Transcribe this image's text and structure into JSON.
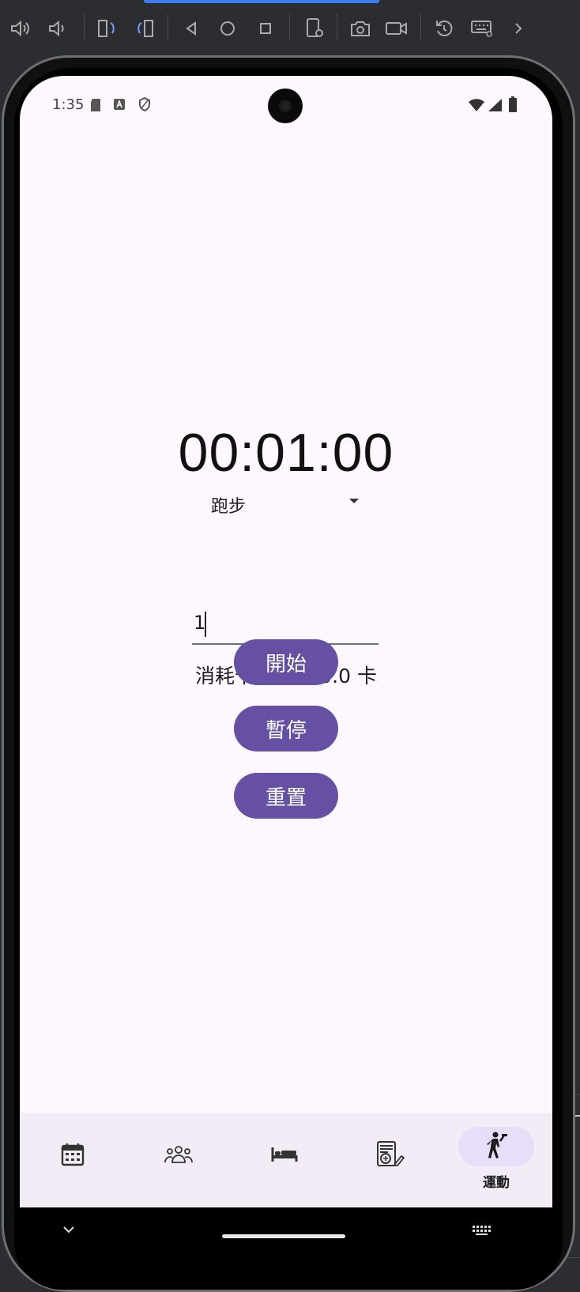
{
  "status_bar": {
    "time": "1:35",
    "icons": [
      "sd-card-icon",
      "text-a-icon",
      "shield-icon",
      "wifi-icon",
      "signal-icon",
      "battery-icon"
    ]
  },
  "emulator_toolbar": {
    "icons": [
      "volume-up-icon",
      "volume-down-icon",
      "rotate-left-icon",
      "rotate-right-icon",
      "back-icon",
      "home-icon",
      "overview-icon",
      "device-settings-icon",
      "camera-icon",
      "video-record-icon",
      "reset-icon",
      "keyboard-icon",
      "more-icon"
    ],
    "accent_color": "#3d7cf0"
  },
  "timer": {
    "display": "00:01:00"
  },
  "exercise_dropdown": {
    "selected": "跑步"
  },
  "minutes_input": {
    "value": "1"
  },
  "calories": {
    "text": "消耗卡路里: 10.0 卡"
  },
  "buttons": {
    "start": "開始",
    "pause": "暫停",
    "reset": "重置",
    "color": "#6650a4"
  },
  "bottom_nav": {
    "items": [
      {
        "icon": "calendar-icon",
        "label": ""
      },
      {
        "icon": "people-icon",
        "label": ""
      },
      {
        "icon": "bed-icon",
        "label": ""
      },
      {
        "icon": "diet-plan-icon",
        "label": ""
      },
      {
        "icon": "exercise-icon",
        "label": "運動"
      }
    ],
    "active_index": 4,
    "active_pill_color": "#e8def8",
    "background": "#f2ecf6"
  },
  "screen_background": "#fef7fe"
}
